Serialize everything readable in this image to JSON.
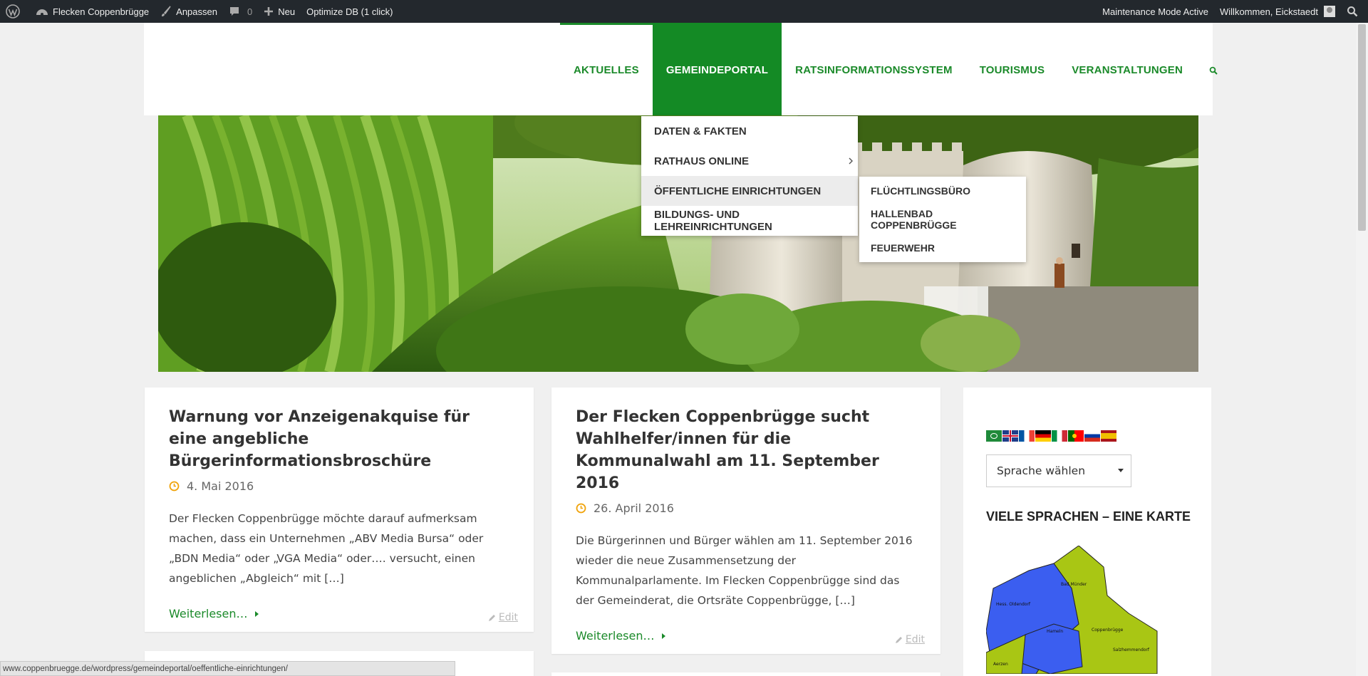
{
  "adminbar": {
    "site_name": "Flecken Coppenbrügge",
    "customize": "Anpassen",
    "comments_count": "0",
    "new_label": "Neu",
    "optimize": "Optimize DB (1 click)",
    "maintenance": "Maintenance Mode Active",
    "welcome": "Willkommen, Eickstaedt"
  },
  "nav": {
    "items": [
      "Aktuelles",
      "Gemeindeportal",
      "Ratsinformationssystem",
      "Tourismus",
      "Veranstaltungen"
    ],
    "active": "Gemeindeportal",
    "search_icon": "search-icon"
  },
  "dropdown": {
    "items": [
      "Daten & Fakten",
      "Rathaus online",
      "Öffentliche Einrichtungen",
      "Bildungs- und Lehreinrichtungen"
    ],
    "hover": "Öffentliche Einrichtungen",
    "submenu": [
      "Flüchtlingsbüro",
      "Hallenbad Coppenbrügge",
      "Feuerwehr"
    ]
  },
  "posts": [
    {
      "title": "Warnung vor Anzeigenakquise für eine angebliche Bürgerinformationsbroschüre",
      "date": "4. Mai 2016",
      "excerpt": "Der Flecken Coppenbrügge möchte darauf aufmerksam machen, dass ein Unternehmen „ABV Media Bursa“ oder „BDN Media“ oder „VGA Media“ oder…. versucht, einen angeblichen „Abgleich“ mit […]",
      "more": "Weiterlesen…",
      "edit": "Edit"
    },
    {
      "title": "Der Flecken Coppenbrügge sucht Wahlhelfer/innen für die Kommunalwahl am 11. September 2016",
      "date": "26. April 2016",
      "excerpt": "Die Bürgerinnen und Bürger wählen am 11. September 2016 wieder die neue Zusammensetzung der Kommunalparlamente. Im Flecken Coppenbrügge sind das der Gemeinderat, die Ortsräte Coppenbrügge, […]",
      "more": "Weiterlesen…",
      "edit": "Edit"
    }
  ],
  "sidebar": {
    "language_select": "Sprache wählen",
    "widget_title": "VIELE SPRACHEN – EINE KARTE",
    "map_labels": [
      "Bad Münder",
      "Hess. Oldendorf",
      "Coppenbrügge",
      "Hameln",
      "Salzhemmendorf",
      "Aerzen"
    ]
  },
  "statusbar": {
    "url": "www.coppenbruegge.de/wordpress/gemeindeportal/oeffentliche-einrichtungen/"
  },
  "colors": {
    "brand_green": "#1b8a2a",
    "admin_bar": "#23282d",
    "accent_orange": "#f0a30a"
  }
}
